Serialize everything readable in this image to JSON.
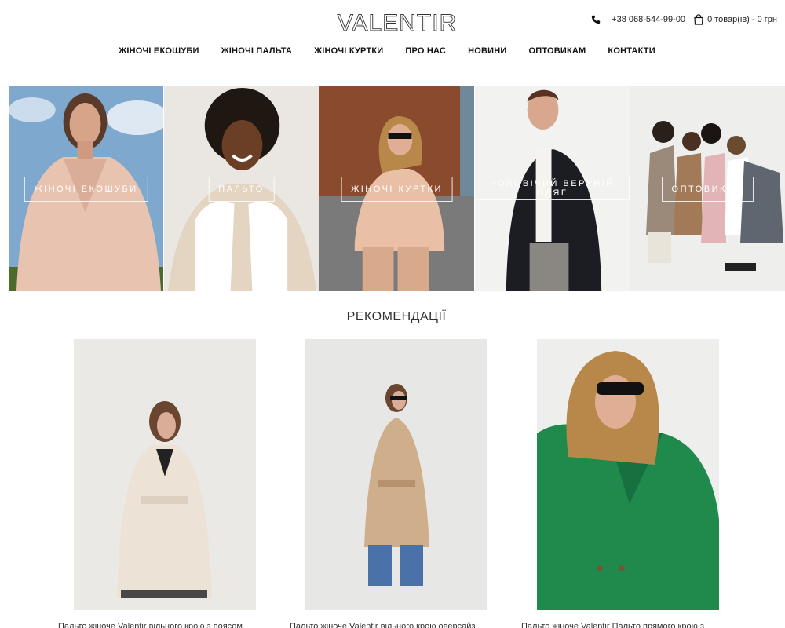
{
  "brand": {
    "logo_text": "VALENTIR"
  },
  "topbar": {
    "phone": "+38 068-544-99-00",
    "cart": "0 товар(ів) - 0 грн"
  },
  "nav": [
    "ЖІНОЧІ ЕКОШУБИ",
    "ЖІНОЧІ ПАЛЬТА",
    "ЖІНОЧІ КУРТКИ",
    "ПРО НАС",
    "НОВИНИ",
    "ОПТОВИКАМ",
    "КОНТАКТИ"
  ],
  "categories": [
    {
      "label": "ЖІНОЧІ ЕКОШУБИ"
    },
    {
      "label": "ПАЛЬТО"
    },
    {
      "label": "ЖІНОЧІ КУРТКИ"
    },
    {
      "label": "ЧОЛОВІЧИЙ ВЕРХНІЙ ОДЯГ"
    },
    {
      "label": "ОПТОВИКАМ"
    }
  ],
  "recommendations": {
    "title": "РЕКОМЕНДАЦІЇ",
    "products": [
      {
        "name": "Пальто жіноче Valentir вільного крою з поясом"
      },
      {
        "name": "Пальто жіноче Valentir вільного крою оверсайз"
      },
      {
        "name": "Пальто жіноче Valentir Пальто прямого крою з"
      }
    ]
  },
  "colors": {
    "accent_text": "#111111",
    "coat_green": "#1f8a4c",
    "coat_beige": "#cfae8c"
  }
}
